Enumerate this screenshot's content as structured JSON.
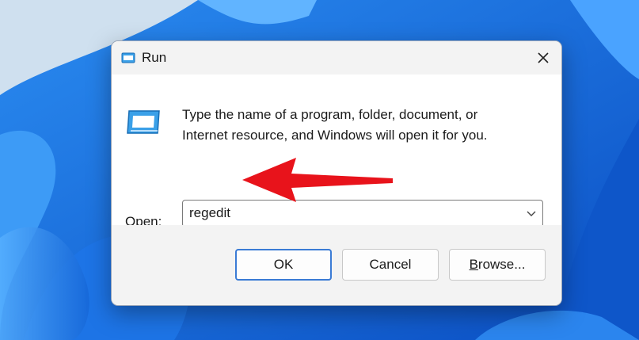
{
  "window": {
    "title": "Run",
    "description_line1": "Type the name of a program, folder, document, or",
    "description_line2": "Internet resource, and Windows will open it for you.",
    "open_label_accel": "O",
    "open_label_rest": "pen:",
    "open_value": "regedit",
    "buttons": {
      "ok": "OK",
      "cancel": "Cancel",
      "browse_accel": "B",
      "browse_rest": "rowse..."
    }
  },
  "icons": {
    "title": "run-icon",
    "close": "close-icon",
    "dropdown": "chevron-down-icon",
    "annotation": "red-arrow-icon"
  },
  "colors": {
    "accent": "#3a7bd5",
    "annotation_arrow": "#e8131b",
    "wallpaper": "#1a6fe0"
  }
}
